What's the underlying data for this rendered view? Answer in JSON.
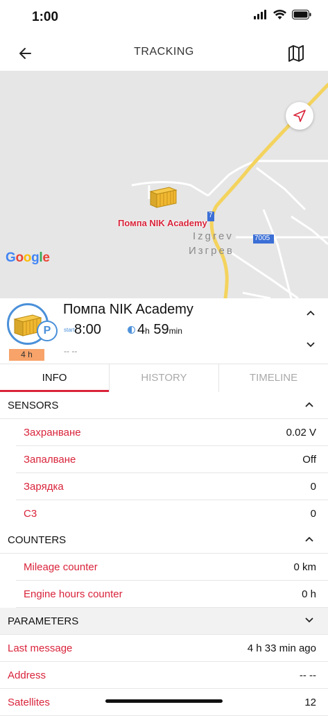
{
  "status": {
    "time": "1:00"
  },
  "nav": {
    "title": "TRACKING"
  },
  "map": {
    "marker_label": "Помпа NIK Academy",
    "town_latin": "Izgrev",
    "town_cyrillic": "Изгрев",
    "road_number": "7005",
    "road_small": "7",
    "google": [
      "G",
      "o",
      "o",
      "g",
      "l",
      "e"
    ]
  },
  "object": {
    "name": "Помпа NIK Academy",
    "badge_letter": "P",
    "duration_badge": "4 h",
    "start_label": "start",
    "start_time": "8:00",
    "dur_hours": "4",
    "dur_h_unit": "h",
    "dur_minutes": "59",
    "dur_min_unit": "min",
    "extra": "-- --"
  },
  "tabs": [
    {
      "label": "INFO",
      "active": true
    },
    {
      "label": "HISTORY",
      "active": false
    },
    {
      "label": "TIMELINE",
      "active": false
    }
  ],
  "sections": {
    "sensors": {
      "title": "SENSORS",
      "items": [
        {
          "label": "Захранване",
          "value": "0.02 V"
        },
        {
          "label": "Запалване",
          "value": "Off"
        },
        {
          "label": "Зарядка",
          "value": "0"
        },
        {
          "label": "C3",
          "value": "0"
        }
      ]
    },
    "counters": {
      "title": "COUNTERS",
      "items": [
        {
          "label": "Mileage counter",
          "value": "0 km"
        },
        {
          "label": "Engine hours counter",
          "value": "0 h"
        }
      ]
    },
    "parameters": {
      "title": "PARAMETERS"
    }
  },
  "params": [
    {
      "label": "Last message",
      "value": "4 h 33 min ago"
    },
    {
      "label": "Address",
      "value": "-- --"
    },
    {
      "label": "Satellites",
      "value": "12"
    }
  ],
  "colors": {
    "accent": "#d9233a",
    "blue": "#4a90d9",
    "badge": "#f7a36a"
  }
}
